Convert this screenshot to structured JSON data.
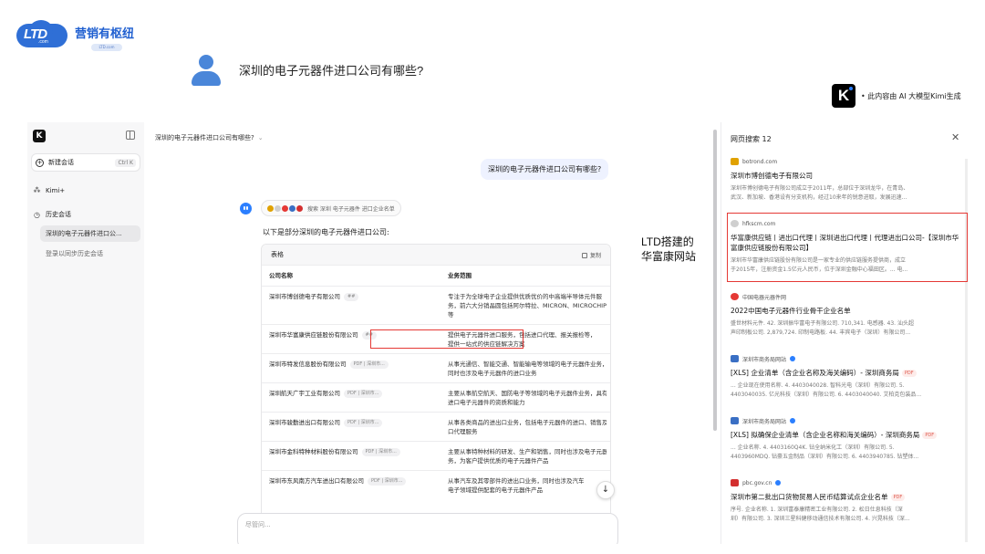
{
  "brand": {
    "name": "营销有枢纽",
    "logo_text": "LTD",
    "logo_sub": ".com",
    "badge": "LTD.com"
  },
  "question": {
    "text": "深圳的电子元器件进口公司有哪些?"
  },
  "kimi_credit": {
    "logo": "K",
    "text": "• 此内容由 AI 大模型Kimi生成"
  },
  "sidebar": {
    "logo": "K",
    "new_chat": {
      "label": "新建会话",
      "shortcut": "Ctrl  K"
    },
    "kimi_plus": "Kimi+",
    "history_label": "历史会话",
    "history_items": [
      "深圳的电子元器件进口公...",
      "登录以同步历史会话"
    ]
  },
  "chat": {
    "title": "深圳的电子元器件进口公司有哪些?",
    "user_bubble": "深圳的电子元器件进口公司有哪些?",
    "search_chip": "搜索 深圳 电子元器件 进口企业名单",
    "intro": "以下是部分深圳的电子元器件进口公司:",
    "table_label": "表格",
    "copy_label": "复制",
    "columns": [
      "公司名称",
      "业务范围"
    ],
    "rows": [
      {
        "name": "深圳市博创德电子有限公司",
        "tag": "##",
        "scope": [
          "专注于为全球电子企业提供优质优价的中高端半导体元件服",
          "务，前六大分销晶圆包括阿尔特拉、MICRON、MICROCHIP",
          "等"
        ]
      },
      {
        "name": "深圳市华富康供应链股份有限公司",
        "tag": "##",
        "scope": [
          "提供电子元器件进口服务，包括进口代理、报关报检等，",
          "提供一站式的供应链解决方案"
        ]
      },
      {
        "name": "深圳市特发信息股份有限公司",
        "tag": "PDF | 深圳市...",
        "scope": [
          "从事光通信、智能交通、智能输电等领域的电子元器件业务，",
          "同时也涉及电子元器件的进口业务"
        ]
      },
      {
        "name": "深圳航天广宇工业有限公司",
        "tag": "PDF | 深圳市...",
        "scope": [
          "主要从事航空航天、国防电子等领域的电子元器件业务，具有",
          "进口电子元器件的资质和能力"
        ]
      },
      {
        "name": "深圳市骏勤进出口有限公司",
        "tag": "PDF | 深圳市...",
        "scope": [
          "从事各类商品的进出口业务，包括电子元器件的进口、销售及",
          "口代理服务"
        ]
      },
      {
        "name": "深圳市金科特种材料股份有限公司",
        "tag": "PDF | 深圳市...",
        "scope": [
          "主要从事特种材料的研发、生产和销售，同时也涉及电子元器件",
          "务，为客户提供优质的电子元器件产品"
        ]
      },
      {
        "name": "深圳市东风南方汽车进出口有限公司",
        "tag": "PDF | 深圳市...",
        "scope": [
          "从事汽车及其零部件的进出口业务，同时也涉及汽车",
          "电子领域提供配套的电子元器件产品"
        ]
      }
    ],
    "input_placeholder": "尽管问..."
  },
  "annotation": {
    "line1": "LTD搭建的",
    "line2": "华富康网站"
  },
  "panel": {
    "title": "网页搜索 12",
    "sources": [
      {
        "site": "botrond.com",
        "title": "深圳市博创德电子有限公司",
        "snippet": [
          "深圳市博创德电子有限公司成立于2011年，总部位于深圳龙华，在青岛、",
          "武汉、新加坡、香港设有分支机构，经过10来年的锐意进取，发展迅速..."
        ],
        "icon_color": "#e0a100"
      },
      {
        "site": "hfkscm.com",
        "title": "华富康供应链丨进出口代理丨深圳进出口代理丨代理进出口公司-【深圳市华富康供应链股份有限公司】",
        "snippet": [
          "深圳市华富康供应链股份有限公司是一家专业的供应链服务提供商，成立",
          "于2015年，注册资金1.5亿元人民币，位于深圳金融中心福田区。... 电..."
        ],
        "icon_color": "#cfcfcf"
      },
      {
        "site": "中国电器元器件网",
        "title": "2022中国电子元器件行业骨干企业名单",
        "snippet": [
          "盛世材料元件. 42. 深圳振华富电子有限公司. 710,341. 电感器. 43. 汕头超",
          "声印制板公司. 2,879,724. 印制电路板. 44. 丰宾电子（深圳）有限公司..."
        ],
        "icon_color": "#e53935"
      },
      {
        "site": "深圳市商务局网站",
        "title": "[XLS] 企业清单（含企业名称及海关编码）- 深圳商务局",
        "pdf": "PDF",
        "snippet": [
          "... 企业现在使用名称. 4. 4403040028. 智科光电（深圳）有限公司. 5.",
          "4403040035. 亿光科技（深圳）有限公司. 6. 4403040040. 艾柏克包装品..."
        ],
        "icon_color": "#3a6fc4"
      },
      {
        "site": "深圳市商务局网站",
        "title": "[XLS] 拟确保企业清单（含企业名称和海关编码）- 深圳商务局",
        "pdf": "PDF",
        "snippet": [
          "... 企业名称. 4. 4403160Q4K. 钻全纳米化工（深圳）有限公司. 5.",
          "4403960MDQ. 钻豪五金制品（深圳）有限公司. 6. 4403940785. 钻塑体..."
        ],
        "icon_color": "#3a6fc4"
      },
      {
        "site": "pbc.gov.cn",
        "title": "深圳市第二批出口货物贸易人民币结算试点企业名单",
        "pdf": "PDF",
        "snippet": [
          "序号. 企业名称. 1. 深圳富泰康精密工业有限公司. 2. 松日仕息科技（深",
          "圳）有限公司. 3. 深圳三星科健移动通信技术有限公司. 4. 兴晃科技（深..."
        ],
        "icon_color": "#d32f2f"
      }
    ]
  }
}
